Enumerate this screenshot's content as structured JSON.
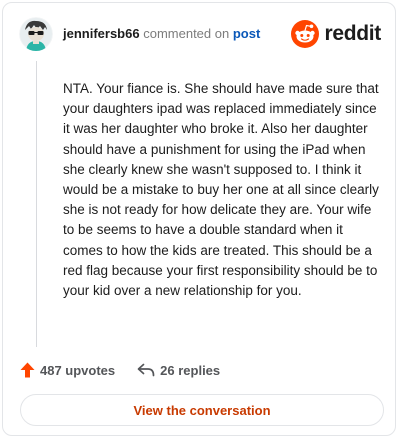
{
  "header": {
    "username": "jennifersb66",
    "action_text": "commented on",
    "post_link": "post",
    "logo_text": "reddit"
  },
  "comment": {
    "text": "NTA. Your fiance is. She should have made sure that your daughters ipad was replaced immediately since it was her daughter who broke it. Also her daughter should have a punishment for using the iPad when she clearly knew she wasn't supposed to. I think it would be a mistake to buy her one at all since clearly she is not ready for how delicate they are. Your wife to be seems to have a double standard when it comes to how the kids are treated. This should be a red flag because your first responsibility should be to your kid over a new relationship for you."
  },
  "actions": {
    "upvotes": "487 upvotes",
    "replies": "26 replies"
  },
  "cta": {
    "label": "View the conversation"
  },
  "colors": {
    "brand_orange": "#ff4500",
    "link_blue": "#0a58b8",
    "cta_text": "#c83a00"
  },
  "icons": [
    "avatar",
    "reddit-logo-icon",
    "upvote-arrow-icon",
    "reply-arrow-icon"
  ]
}
